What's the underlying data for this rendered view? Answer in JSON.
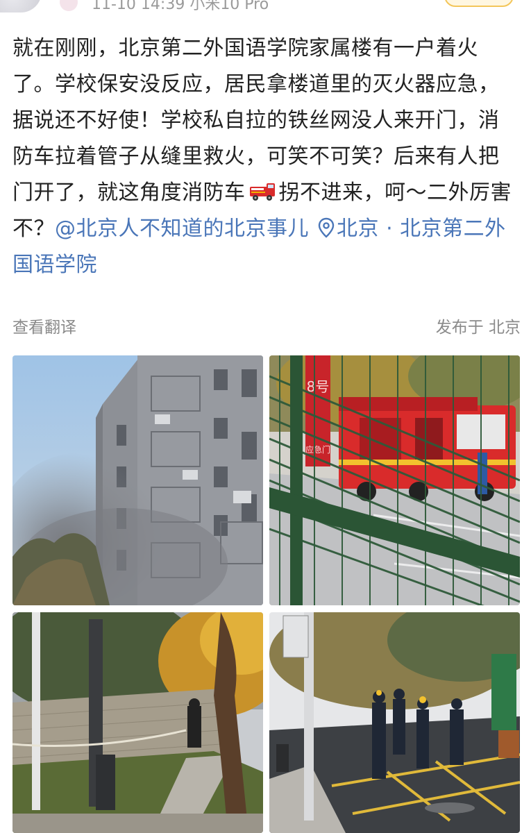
{
  "header": {
    "meta": "11-10 14:39  小米10 Pro"
  },
  "post": {
    "text_main": "就在刚刚，北京第二外国语学院家属楼有一户着火了。学校保安没反应，居民拿楼道里的灭火器应急，据说还不好使！学校私自拉的铁丝网没人来开门，消防车拉着管子从缝里救火，可笑不可笑？后来有人把门开了，就这角度消防车",
    "text_after_emoji": "拐不进来，呵～二外厉害不？",
    "mention": "@北京人不知道的北京事儿",
    "location": "北京 · 北京第二外国语学院",
    "emoji": "fire-engine-emoji"
  },
  "actions": {
    "translate": "查看翻译",
    "posted_from": "发布于 北京"
  },
  "photos": {
    "p2_sign_number": "8号",
    "p2_sign_text": "应急门"
  },
  "colors": {
    "text": "#222222",
    "link": "#4a76b8",
    "muted": "#8a8a8a",
    "firetruck": "#d92b2b",
    "fence": "#2f5a3a"
  }
}
